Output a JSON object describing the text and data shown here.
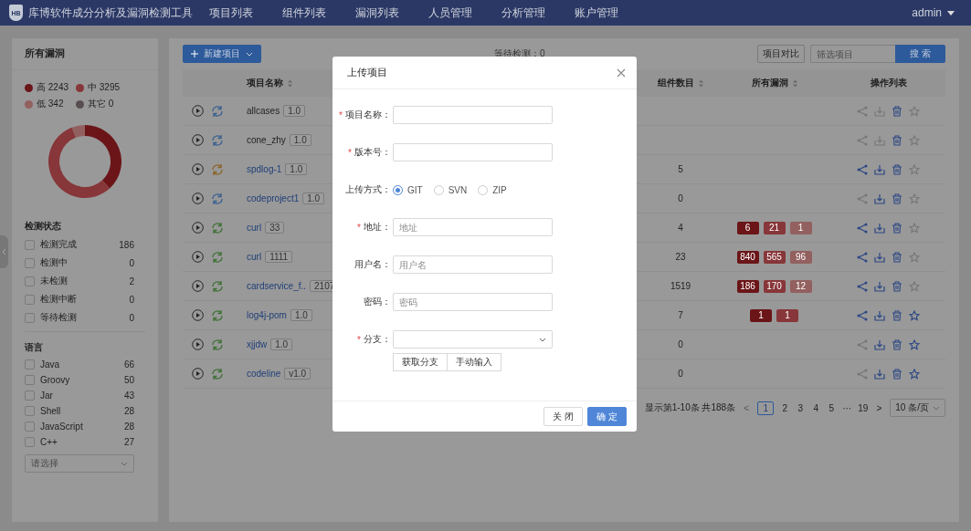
{
  "nav": {
    "logo_mark": "HB",
    "title": "库博软件成分分析及漏洞检测工具",
    "menu": [
      "项目列表",
      "组件列表",
      "漏洞列表",
      "人员管理",
      "分析管理",
      "账户管理"
    ],
    "user": "admin"
  },
  "sidebar": {
    "vuln_title": "所有漏洞",
    "legend": [
      {
        "label": "高",
        "count": "2243",
        "color": "#6b1518"
      },
      {
        "label": "中",
        "count": "3295",
        "color": "#873639"
      },
      {
        "label": "低",
        "count": "342",
        "color": "#92605f"
      },
      {
        "label": "其它",
        "count": "0",
        "color": "#574e4e"
      }
    ],
    "status_title": "检测状态",
    "statuses": [
      {
        "label": "检测完成",
        "count": "186",
        "checked": false
      },
      {
        "label": "检测中",
        "count": "0",
        "checked": false
      },
      {
        "label": "未检测",
        "count": "2",
        "checked": false
      },
      {
        "label": "检测中断",
        "count": "0",
        "checked": false
      },
      {
        "label": "等待检测",
        "count": "0",
        "checked": false
      }
    ],
    "language_title": "语言",
    "languages": [
      {
        "label": "Java",
        "count": "66",
        "checked": false
      },
      {
        "label": "Groovy",
        "count": "50",
        "checked": false
      },
      {
        "label": "Jar",
        "count": "43",
        "checked": false
      },
      {
        "label": "Shell",
        "count": "28",
        "checked": false
      },
      {
        "label": "JavaScript",
        "count": "28",
        "checked": false
      },
      {
        "label": "C++",
        "count": "27",
        "checked": false
      }
    ],
    "language_select": {
      "placeholder": "请选择"
    }
  },
  "main": {
    "new_button": "新建项目",
    "pending": "等待检测：0",
    "compare_button": "项目对比",
    "filter": {
      "placeholder": "筛选项目"
    },
    "search_button": "搜 索",
    "table": {
      "columns": [
        {
          "label": "项目名称",
          "sortable": true
        },
        {
          "label": "组件数目",
          "sortable": true
        },
        {
          "label": "所有漏洞",
          "sortable": true
        },
        {
          "label": "操作列表",
          "sortable": false
        }
      ],
      "rows": [
        {
          "name": "allcases",
          "link": false,
          "version": "1.0",
          "color": "#3a5f8f",
          "share_active": false,
          "download_active": false,
          "star_active": false
        },
        {
          "name": "cone_zhy",
          "link": false,
          "version": "1.0",
          "color": "#3a5f8f",
          "share_active": false,
          "download_active": false,
          "star_active": false
        },
        {
          "name": "spdlog-1",
          "link": true,
          "version": "1.0",
          "color": "#8a6326",
          "components": "5",
          "share_active": true,
          "download_active": true,
          "star_active": false
        },
        {
          "name": "codeproject1",
          "link": true,
          "version": "1.0",
          "color": "#3a5f8f",
          "components": "0",
          "share_active": false,
          "download_active": true,
          "star_active": false
        },
        {
          "name": "curl",
          "link": true,
          "version": "33",
          "color": "#3e7034",
          "components": "4",
          "vulns": [
            {
              "kind": "high",
              "count": "6"
            },
            {
              "kind": "medium",
              "count": "21"
            },
            {
              "kind": "low",
              "count": "1"
            }
          ],
          "share_active": true,
          "download_active": true,
          "star_active": false
        },
        {
          "name": "curl",
          "link": true,
          "version": "1111",
          "color": "#3e7034",
          "components": "23",
          "vulns": [
            {
              "kind": "high",
              "count": "840"
            },
            {
              "kind": "medium",
              "count": "565"
            },
            {
              "kind": "low",
              "count": "96"
            }
          ],
          "share_active": true,
          "download_active": true,
          "star_active": false
        },
        {
          "name": "cardservice_f..",
          "link": true,
          "version": "2107",
          "color": "#3e7034",
          "components": "1519",
          "vulns": [
            {
              "kind": "high",
              "count": "186"
            },
            {
              "kind": "medium",
              "count": "170"
            },
            {
              "kind": "low",
              "count": "12"
            }
          ],
          "share_active": true,
          "download_active": true,
          "star_active": false
        },
        {
          "name": "log4j-pom",
          "link": true,
          "version": "1.0",
          "color": "#3e7034",
          "components": "7",
          "vulns": [
            {
              "kind": "high",
              "count": "1"
            },
            {
              "kind": "medium",
              "count": "1"
            }
          ],
          "share_active": true,
          "download_active": true,
          "star_active": true
        },
        {
          "name": "xjjdw",
          "link": true,
          "version": "1.0",
          "color": "#3e7034",
          "components": "0",
          "share_active": false,
          "download_active": true,
          "star_active": true
        },
        {
          "name": "codeline",
          "link": true,
          "version": "v1.0",
          "color": "#3e7034",
          "components": "0",
          "share_active": false,
          "download_active": true,
          "star_active": true
        }
      ]
    },
    "pagination": {
      "summary": "显示第1-10条 共188条",
      "prev": {
        "label": "<",
        "disabled": true
      },
      "pages": [
        {
          "label": "1",
          "selected": true
        },
        {
          "label": "2",
          "selected": false
        },
        {
          "label": "3",
          "selected": false
        },
        {
          "label": "4",
          "selected": false
        },
        {
          "label": "5",
          "selected": false
        },
        {
          "label": "···",
          "selected": false
        },
        {
          "label": "19",
          "selected": false
        }
      ],
      "next": {
        "label": ">",
        "disabled": false
      },
      "page_size": "10 条/页"
    }
  },
  "modal": {
    "title": "上传项目",
    "fields": [
      {
        "kind": "input",
        "mark": "*",
        "label": "项目名称："
      },
      {
        "kind": "input",
        "mark": "*",
        "label": "版本号："
      },
      {
        "kind": "radio",
        "label": "上传方式：",
        "options": [
          {
            "label": "GIT",
            "selected": true
          },
          {
            "label": "SVN",
            "selected": false
          },
          {
            "label": "ZIP",
            "selected": false
          }
        ]
      },
      {
        "kind": "input",
        "mark": "*",
        "label": "地址：",
        "placeholder": "地址"
      },
      {
        "kind": "input",
        "label": "用户名：",
        "placeholder": "用户名"
      },
      {
        "kind": "input",
        "label": "密码：",
        "placeholder": "密码"
      },
      {
        "kind": "select",
        "mark": "*",
        "label": "分支：",
        "buttons": [
          "获取分支",
          "手动输入"
        ]
      }
    ],
    "buttons": [
      {
        "kind": "default",
        "label": "关 闭"
      },
      {
        "kind": "primary",
        "label": "确 定"
      }
    ]
  }
}
